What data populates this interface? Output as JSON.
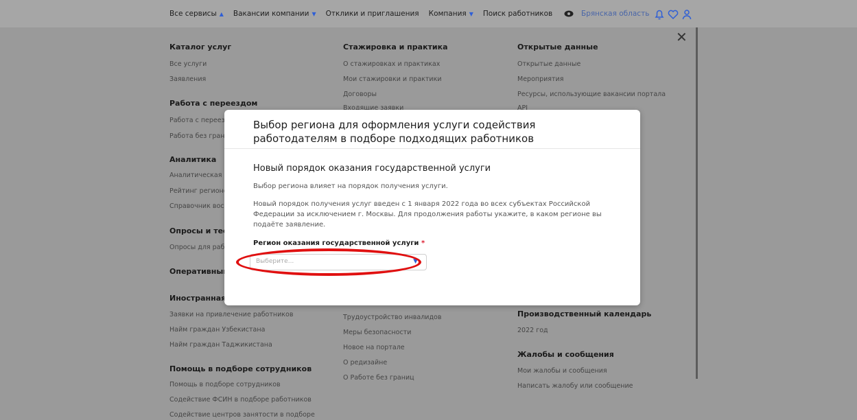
{
  "nav": {
    "items": [
      {
        "label": "Все сервисы",
        "caret": "▲"
      },
      {
        "label": "Вакансии компании",
        "caret": "▼"
      },
      {
        "label": "Отклики и приглашения",
        "caret": ""
      },
      {
        "label": "Компания",
        "caret": "▼"
      },
      {
        "label": "Поиск работников",
        "caret": ""
      }
    ],
    "region": "Брянская область"
  },
  "menu": {
    "col1": {
      "sections": [
        {
          "title": "Каталог услуг",
          "links": [
            "Все услуги",
            "Заявления"
          ]
        },
        {
          "title": "Работа с переездом",
          "links": [
            "Работа с переезд",
            "Работа без грани"
          ]
        },
        {
          "title": "Аналитика",
          "links": [
            "Аналитическая",
            "Рейтинг регионо",
            "Справочник вос"
          ]
        },
        {
          "title": "Опросы и тест",
          "links": [
            "Опросы для раб"
          ]
        },
        {
          "title": "Оперативный",
          "links": []
        },
        {
          "title": "Иностранная",
          "links": [
            "Заявки на привлечение работников",
            "Найм граждан Узбекистана",
            "Найм граждан Таджикистана"
          ]
        },
        {
          "title": "Помощь в подборе сотрудников",
          "links": [
            "Помощь в подборе сотрудников",
            "Содействие ФСИН в подборе работников",
            "Содействие центров занятости в подборе"
          ]
        }
      ]
    },
    "col2": {
      "sections": [
        {
          "title": "Стажировка и практика",
          "links": [
            "О стажировках и практиках",
            "Мои стажировки и практики",
            "Договоры",
            "Входящие заявки"
          ]
        },
        {
          "title": "",
          "links": [
            "Трудоустройство инвалидов",
            "Меры безопасности",
            "Новое на портале",
            "О редизайне",
            "О Работе без границ"
          ]
        }
      ]
    },
    "col3": {
      "sections": [
        {
          "title": "Открытые данные",
          "links": [
            "Открытые данные",
            "Мероприятия",
            "Ресурсы, использующие вакансии портала",
            "API"
          ]
        },
        {
          "title": "Производственный календарь",
          "links": [
            "2022 год"
          ]
        },
        {
          "title": "Жалобы и сообщения",
          "links": [
            "Мои жалобы и сообщения",
            "Написать жалобу или сообщение"
          ]
        }
      ]
    }
  },
  "modal": {
    "title": "Выбор региона для оформления услуги содействия работодателям в подборе подходящих работников",
    "subtitle": "Новый порядок оказания государственной услуги",
    "para1": "Выбор региона влияет на порядок получения услуги.",
    "para2": "Новый порядок получения услуг введен с 1 января 2022 года во всех субъектах Российской Федерации за исключением г. Москвы. Для продолжения работы укажите, в каком регионе вы подаёте заявление.",
    "field_label": "Регион оказания государственной услуги",
    "required_mark": "*",
    "placeholder": "Выберите..."
  },
  "colors": {
    "accent": "#2f5fd6",
    "highlight": "#e01010"
  },
  "icons": [
    "eye-icon",
    "bell-icon",
    "heart-icon",
    "user-icon",
    "close-icon",
    "chevron-down-icon"
  ]
}
